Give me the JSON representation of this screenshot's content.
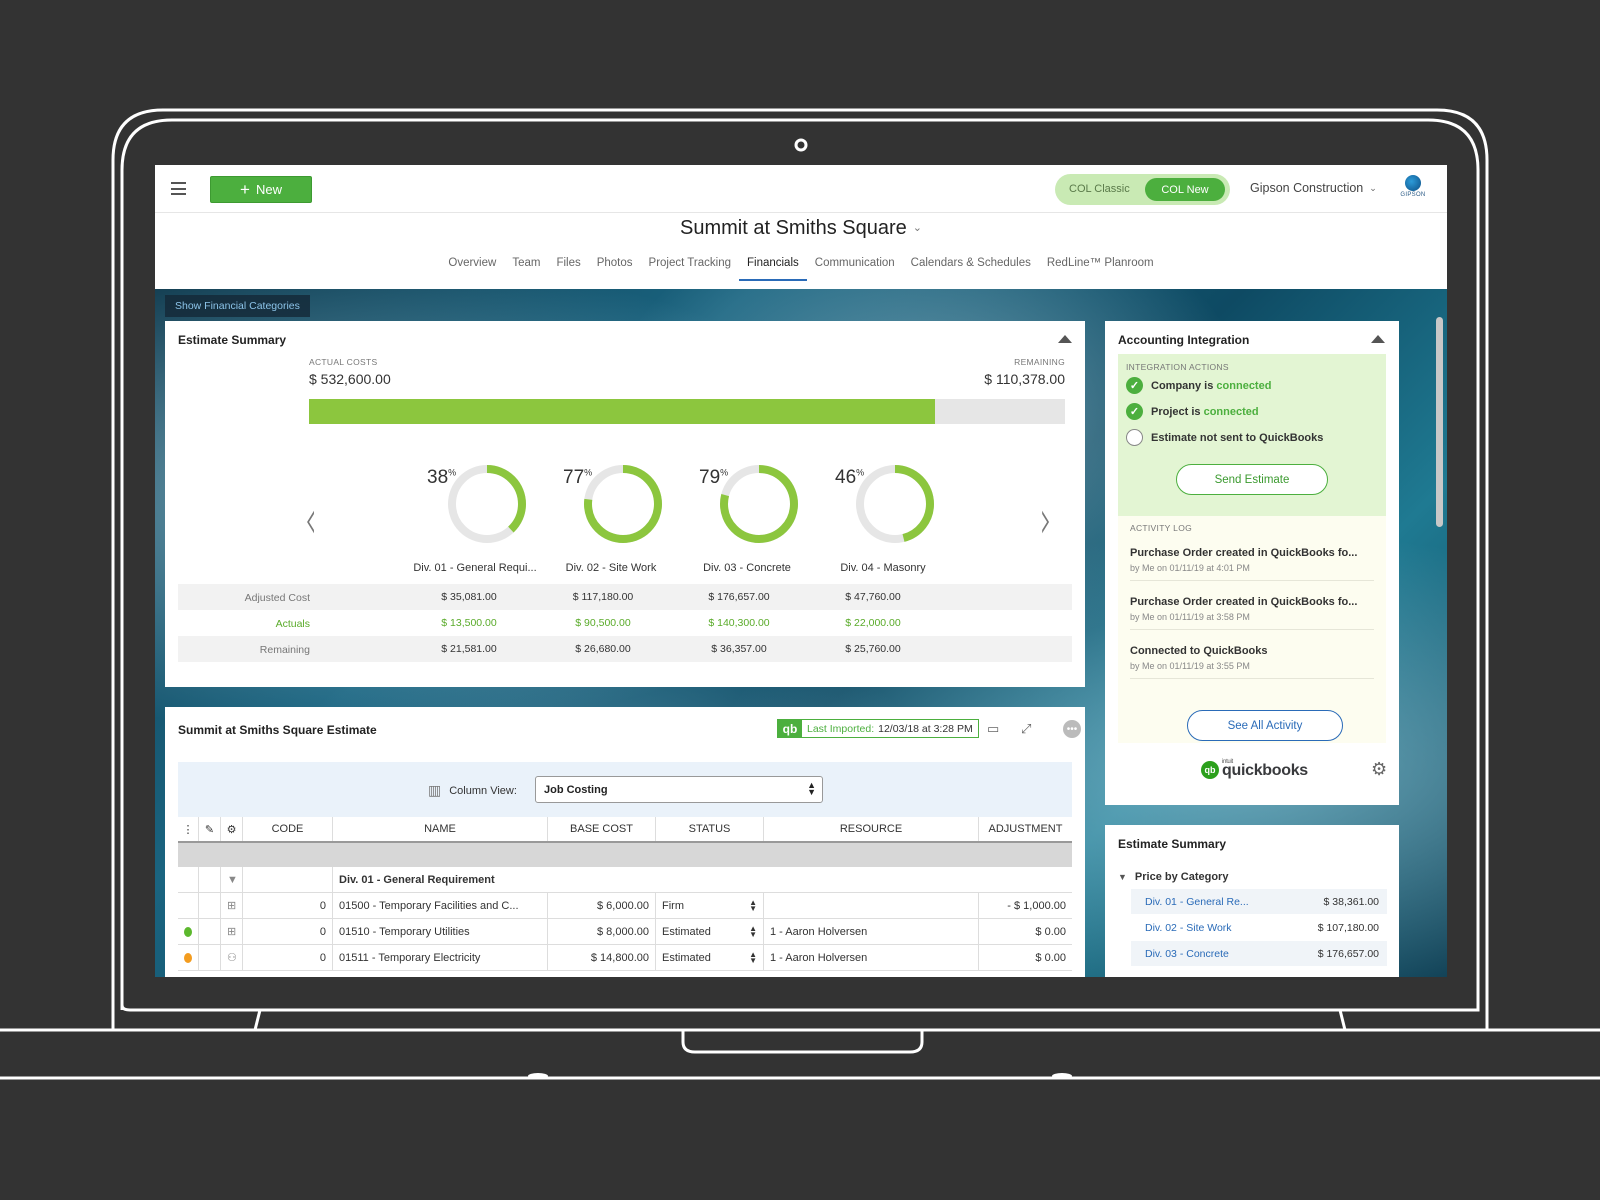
{
  "header": {
    "new_label": "New",
    "col_classic": "COL Classic",
    "col_new": "COL New",
    "company": "Gipson Construction",
    "logo_text": "GIPSON"
  },
  "project": {
    "title": "Summit at Smiths Square",
    "tabs": [
      "Overview",
      "Team",
      "Files",
      "Photos",
      "Project Tracking",
      "Financials",
      "Communication",
      "Calendars & Schedules",
      "RedLine™ Planroom"
    ],
    "active_tab": "Financials"
  },
  "show_categories": "Show Financial Categories",
  "estimate_summary": {
    "title": "Estimate Summary",
    "actual_label": "ACTUAL COSTS",
    "actual_value": "$ 532,600.00",
    "remaining_label": "REMAINING",
    "remaining_value": "$ 110,378.00",
    "progress_fraction": 0.828,
    "divisions": [
      {
        "pct": "38",
        "pct_value": 38,
        "label": "Div. 01 - General Requi..."
      },
      {
        "pct": "77",
        "pct_value": 77,
        "label": "Div. 02 - Site Work"
      },
      {
        "pct": "79",
        "pct_value": 79,
        "label": "Div. 03 - Concrete"
      },
      {
        "pct": "46",
        "pct_value": 46,
        "label": "Div. 04 - Masonry"
      }
    ],
    "rows": [
      {
        "label": "Adjusted Cost",
        "values": [
          "$ 35,081.00",
          "$ 117,180.00",
          "$ 176,657.00",
          "$ 47,760.00"
        ]
      },
      {
        "label": "Actuals",
        "values": [
          "$ 13,500.00",
          "$ 90,500.00",
          "$ 140,300.00",
          "$ 22,000.00"
        ]
      },
      {
        "label": "Remaining",
        "values": [
          "$ 21,581.00",
          "$ 26,680.00",
          "$ 36,357.00",
          "$ 25,760.00"
        ]
      }
    ]
  },
  "accounting": {
    "title": "Accounting Integration",
    "actions_label": "INTEGRATION ACTIONS",
    "company_prefix": "Company is",
    "project_prefix": "Project is",
    "connected": "connected",
    "estimate_status": "Estimate not sent to QuickBooks",
    "send_button": "Send Estimate",
    "activity_label": "ACTIVITY LOG",
    "log": [
      {
        "title": "Purchase Order created in QuickBooks fo...",
        "sub": "by Me on 01/11/19 at 4:01 PM"
      },
      {
        "title": "Purchase Order created in QuickBooks fo...",
        "sub": "by Me on 01/11/19 at 3:58 PM"
      },
      {
        "title": "Connected to QuickBooks",
        "sub": "by Me on 01/11/19 at 3:55 PM"
      }
    ],
    "see_all": "See All Activity",
    "qb_intuit": "intuit",
    "qb_brand": "quickbooks"
  },
  "estimate_table": {
    "title": "Summit at Smiths Square Estimate",
    "last_imported_label": "Last Imported:",
    "last_imported_value": "12/03/18 at 3:28 PM",
    "column_view_label": "Column View:",
    "column_view_value": "Job Costing",
    "columns": [
      "CODE",
      "NAME",
      "BASE COST",
      "STATUS",
      "RESOURCE",
      "ADJUSTMENT"
    ],
    "group_name": "Div. 01 - General Requirement",
    "rows": [
      {
        "code": "0",
        "name": "01500 - Temporary Facilities and C...",
        "base": "$ 6,000.00",
        "status": "Firm",
        "resource": "",
        "adj": "- $ 1,000.00",
        "dot": ""
      },
      {
        "code": "0",
        "name": "01510 - Temporary Utilities",
        "base": "$ 8,000.00",
        "status": "Estimated",
        "resource": "1 - Aaron Holversen",
        "adj": "$ 0.00",
        "dot": "#5cb82d"
      },
      {
        "code": "0",
        "name": "01511 - Temporary Electricity",
        "base": "$ 14,800.00",
        "status": "Estimated",
        "resource": "1 - Aaron Holversen",
        "adj": "$ 0.00",
        "dot": "#f39c1f"
      }
    ]
  },
  "side_summary": {
    "title": "Estimate Summary",
    "group": "Price by Category",
    "rows": [
      {
        "name": "Div. 01 - General Re...",
        "value": "$ 38,361.00"
      },
      {
        "name": "Div. 02 - Site Work",
        "value": "$ 107,180.00"
      },
      {
        "name": "Div. 03 - Concrete",
        "value": "$ 176,657.00"
      }
    ]
  },
  "colors": {
    "accent_green": "#4caf3e",
    "progress_green": "#8cc63e",
    "link_blue": "#2a6bb8"
  }
}
